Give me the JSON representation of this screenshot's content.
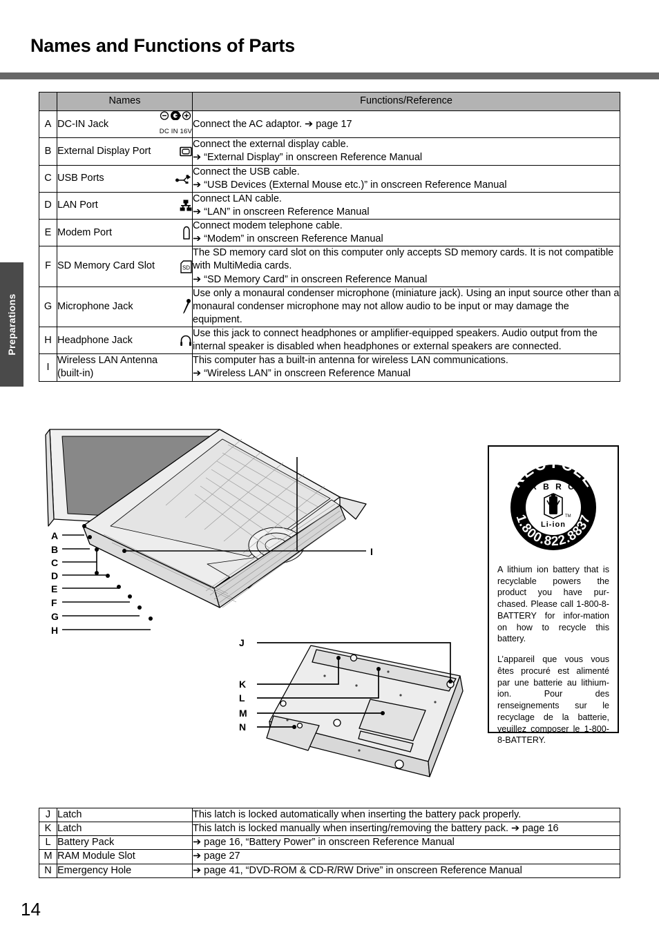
{
  "page": {
    "title": "Names and Functions of Parts",
    "number": "14",
    "side_tab": "Preparations",
    "rule_color": "#676767",
    "header_fill": "#b3b3b3",
    "tab_fill": "#4a4a4a"
  },
  "main_table": {
    "headers": [
      "Names",
      "Functions/Reference"
    ],
    "rows": [
      {
        "index": "A",
        "name": "DC-IN Jack",
        "icon": "dc-in-jack-icon",
        "icon_caption": "DC IN 16V",
        "function_lines": [
          "Connect the AC adaptor. ➔ page 17"
        ]
      },
      {
        "index": "B",
        "name": "External Display Port",
        "icon": "external-display-port-icon",
        "function_lines": [
          "Connect the external display cable.",
          "➔ “External Display” in onscreen Reference Manual"
        ]
      },
      {
        "index": "C",
        "name": "USB Ports",
        "icon": "usb-icon",
        "function_lines": [
          "Connect the USB cable.",
          "➔ “USB Devices (External Mouse etc.)” in onscreen Reference Manual"
        ]
      },
      {
        "index": "D",
        "name": "LAN Port",
        "icon": "lan-port-icon",
        "function_lines": [
          "Connect LAN cable.",
          "➔ “LAN” in onscreen Reference Manual"
        ]
      },
      {
        "index": "E",
        "name": "Modem Port",
        "icon": "modem-port-icon",
        "function_lines": [
          "Connect modem telephone cable.",
          "➔ “Modem” in onscreen Reference Manual"
        ]
      },
      {
        "index": "F",
        "name": "SD Memory Card Slot",
        "icon": "sd-card-icon",
        "function_lines": [
          "The SD memory card slot on this computer only accepts SD memory cards. It is not compatible with MultiMedia cards.",
          "➔ “SD Memory Card” in onscreen Reference Manual"
        ]
      },
      {
        "index": "G",
        "name": "Microphone Jack",
        "icon": "microphone-icon",
        "function_lines": [
          "Use only a monaural condenser microphone (miniature jack).  Using an input source other than a monaural condenser microphone may not allow audio to be input or may damage the equipment."
        ]
      },
      {
        "index": "H",
        "name": "Headphone Jack",
        "icon": "headphone-icon",
        "function_lines": [
          "Use this jack to connect headphones or amplifier-equipped speakers. Audio output from the internal speaker is disabled when headphones or external speakers are connected."
        ]
      },
      {
        "index": "I",
        "name": "Wireless LAN Antenna (built-in)",
        "name_line1": "Wireless LAN Antenna",
        "name_line2": "(built-in)",
        "icon": "",
        "function_lines": [
          "This computer has a built-in antenna for wireless LAN communications.",
          "➔ “Wireless LAN” in onscreen Reference Manual"
        ]
      }
    ]
  },
  "bottom_table": {
    "rows": [
      {
        "index": "J",
        "name": "Latch",
        "function_lines": [
          "This latch is locked automatically when inserting the battery pack properly."
        ]
      },
      {
        "index": "K",
        "name": "Latch",
        "function_lines": [
          "This latch is locked manually when inserting/removing the battery pack. ➔ page 16"
        ]
      },
      {
        "index": "L",
        "name": "Battery Pack",
        "function_lines": [
          "➔ page 16, “Battery Power” in onscreen Reference Manual"
        ]
      },
      {
        "index": "M",
        "name": "RAM Module Slot",
        "function_lines": [
          "➔ page 27"
        ]
      },
      {
        "index": "N",
        "name": "Emergency Hole",
        "function_lines": [
          "➔ page 41, “DVD-ROM & CD-R/RW Drive” in onscreen Reference Manual"
        ]
      }
    ]
  },
  "figure": {
    "top_caption": "laptop-open-view-diagram",
    "bottom_caption": "laptop-underside-diagram",
    "top_labels": [
      "A",
      "B",
      "C",
      "D",
      "E",
      "F",
      "G",
      "H",
      "I"
    ],
    "bottom_labels": [
      "J",
      "K",
      "L",
      "M",
      "N"
    ]
  },
  "recycle": {
    "logo": {
      "top_arc": "RECYCLE",
      "bottom_arc": "1.800.822.8837",
      "inner_top": "R B R C",
      "inner_bottom": "Li-ion",
      "tm": "TM"
    },
    "paragraph_en": "A lithium ion battery that is recyclable powers the product you have pur-chased.  Please call 1-800-8-BATTERY for infor-mation on how to recycle this battery.",
    "paragraph_fr": "L’appareil que vous vous êtes procuré est alimenté par une batterie au lithium-ion. Pour des renseignements sur le recyclage de la batterie, veuillez composer le 1-800-8-BATTERY."
  }
}
